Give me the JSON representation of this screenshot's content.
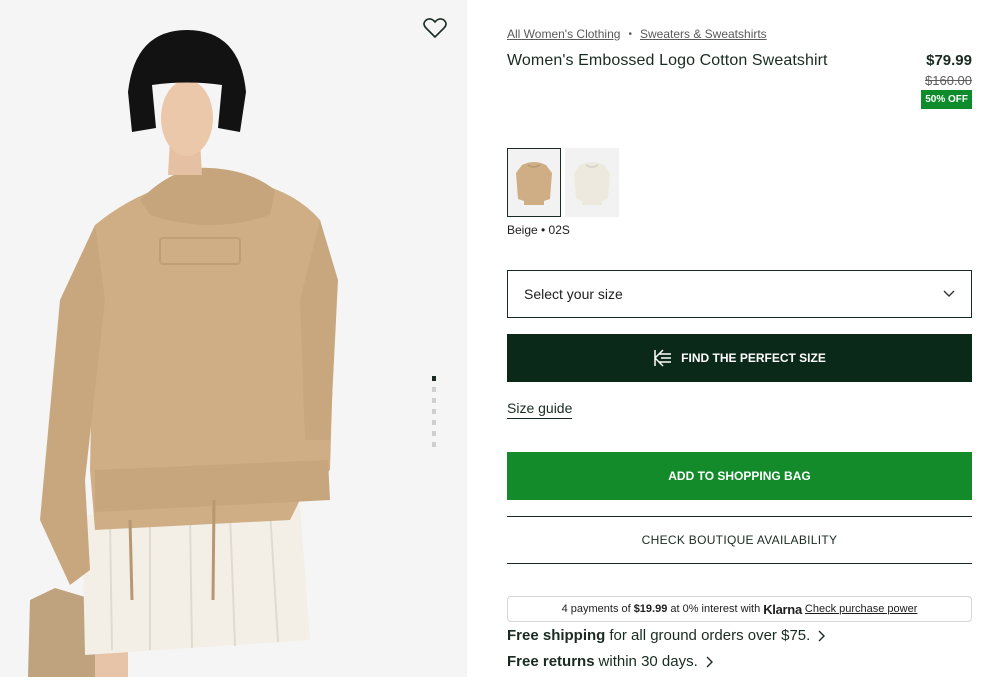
{
  "breadcrumb": {
    "first": "All Women's Clothing",
    "separator": "•",
    "second": "Sweaters & Sweatshirts"
  },
  "product": {
    "title": "Women's Embossed Logo Cotton Sweatshirt",
    "price_now": "$79.99",
    "price_old": "$160.00",
    "discount": "50% OFF",
    "color_label": "Beige • 02S"
  },
  "swatches": [
    {
      "color": "#cfae85"
    },
    {
      "color": "#f1ede4"
    }
  ],
  "gallery": {
    "image_count": 7,
    "active_index": 0
  },
  "size_select": {
    "placeholder": "Select your size"
  },
  "buttons": {
    "perfect_size": "FIND THE PERFECT SIZE",
    "size_guide": "Size guide",
    "add_to_bag": "ADD TO SHOPPING BAG",
    "boutique": "CHECK BOUTIQUE AVAILABILITY"
  },
  "klarna": {
    "prefix": "4 payments of",
    "amount": "$19.99",
    "middle": "at 0% interest with",
    "brand": "Klarna",
    "link": "Check purchase power"
  },
  "shipping": {
    "free_shipping_bold": "Free shipping",
    "free_shipping_rest": "for all ground orders over $75.",
    "free_returns_bold": "Free returns",
    "free_returns_rest": "within 30 days."
  },
  "colors": {
    "dark_green": "#0b2918",
    "brand_green": "#138b2b",
    "discount_green": "#0e8c2c"
  }
}
